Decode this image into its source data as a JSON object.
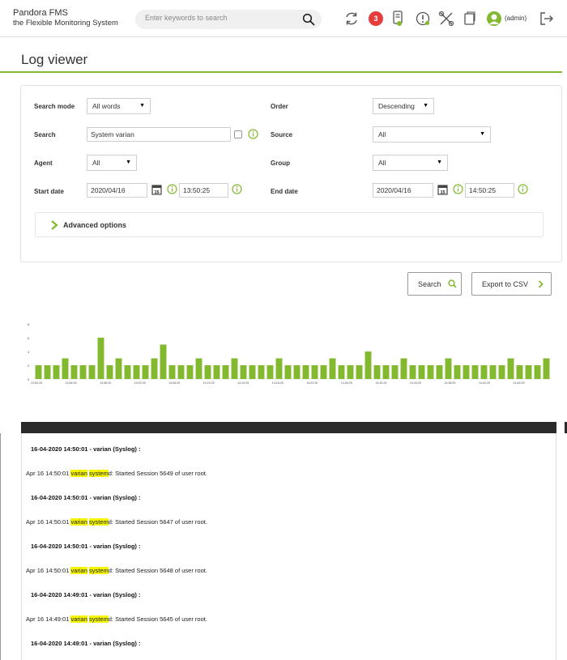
{
  "header": {
    "brand_name": "Pandora FMS",
    "brand_sub": "the Flexible Monitoring System",
    "search_placeholder": "Enter keywords to search",
    "notification_count": "3",
    "user_label": "(admin)"
  },
  "page": {
    "title": "Log viewer"
  },
  "filters": {
    "search_mode_label": "Search mode",
    "search_mode_value": "All words",
    "order_label": "Order",
    "order_value": "Descending",
    "search_label": "Search",
    "search_value": "System varian",
    "source_label": "Source",
    "source_value": "All",
    "agent_label": "Agent",
    "agent_value": "All",
    "group_label": "Group",
    "group_value": "All",
    "start_date_label": "Start date",
    "start_date": "2020/04/16",
    "start_time": "13:50:25",
    "end_date_label": "End date",
    "end_date": "2020/04/16",
    "end_time": "14:50:25",
    "advanced_label": "Advanced options"
  },
  "buttons": {
    "search": "Search",
    "export": "Export to CSV"
  },
  "colors": {
    "accent": "#82b92e",
    "bar": "#82b92e",
    "badge": "#e63c3c",
    "highlight": "#f5f500",
    "log_header": "#2b2b2b"
  },
  "chart_data": {
    "type": "bar",
    "y_ticks": [
      "0",
      "2",
      "4",
      "6",
      "8"
    ],
    "ylim": [
      0,
      8
    ],
    "x_ticks": [
      "13:50:25",
      "13:54:25",
      "13:58:25",
      "14:02:25",
      "14:06:25",
      "14:10:25",
      "14:14:25",
      "14:18:25",
      "14:22:25",
      "14:26:25",
      "14:30:25",
      "14:34:25",
      "14:38:25",
      "14:42:25",
      "14:46:25"
    ],
    "values": [
      2,
      2,
      2,
      3,
      2,
      2,
      2,
      6,
      2,
      3,
      2,
      2,
      2,
      3,
      5,
      2,
      2,
      2,
      3,
      2,
      2,
      2,
      3,
      2,
      2,
      2,
      2,
      3,
      2,
      2,
      2,
      2,
      2,
      3,
      2,
      2,
      2,
      4,
      2,
      2,
      2,
      3,
      2,
      2,
      2,
      2,
      3,
      2,
      2,
      2,
      2,
      2,
      2,
      3,
      2,
      2,
      2,
      3
    ]
  },
  "log": {
    "entries": [
      {
        "title": "16-04-2020 14:50:01 - varian (Syslog) :",
        "prefix": "Apr 16 14:50:01 ",
        "hl1": "varian",
        "sp": " ",
        "hl2": "system",
        "suffix": "d: Started Session 5649 of user root."
      },
      {
        "title": "16-04-2020 14:50:01 - varian (Syslog) :",
        "prefix": "Apr 16 14:50:01 ",
        "hl1": "varian",
        "sp": " ",
        "hl2": "system",
        "suffix": "d: Started Session 5647 of user root."
      },
      {
        "title": "16-04-2020 14:50:01 - varian (Syslog) :",
        "prefix": "Apr 16 14:50:01 ",
        "hl1": "varian",
        "sp": " ",
        "hl2": "system",
        "suffix": "d: Started Session 5648 of user root."
      },
      {
        "title": "16-04-2020 14:49:01 - varian (Syslog) :",
        "prefix": "Apr 16 14:49:01 ",
        "hl1": "varian",
        "sp": " ",
        "hl2": "system",
        "suffix": "d: Started Session 5645 of user root."
      },
      {
        "title": "16-04-2020 14:49:01 - varian (Syslog) :"
      }
    ]
  }
}
